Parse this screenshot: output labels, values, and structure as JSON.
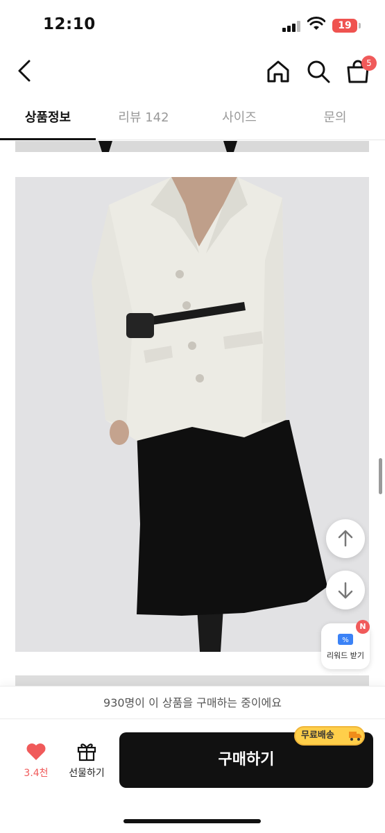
{
  "status_bar": {
    "time": "12:10",
    "battery": "19"
  },
  "header": {
    "cart_count": "5"
  },
  "tabs": [
    {
      "label": "상품정보",
      "active": true
    },
    {
      "label": "리뷰 142",
      "active": false
    },
    {
      "label": "사이즈",
      "active": false
    },
    {
      "label": "문의",
      "active": false
    }
  ],
  "floating": {
    "reward_label": "리워드 받기",
    "reward_badge": "N"
  },
  "bottom": {
    "buyers_text": "930명이 이 상품을 구매하는 중이에요",
    "like_count": "3.4천",
    "gift_label": "선물하기",
    "buy_label": "구매하기",
    "shipping_badge": "무료배송"
  },
  "colors": {
    "accent": "#f05a5a",
    "buy_button": "#111111",
    "shipping_badge": "#ffcf4a"
  }
}
